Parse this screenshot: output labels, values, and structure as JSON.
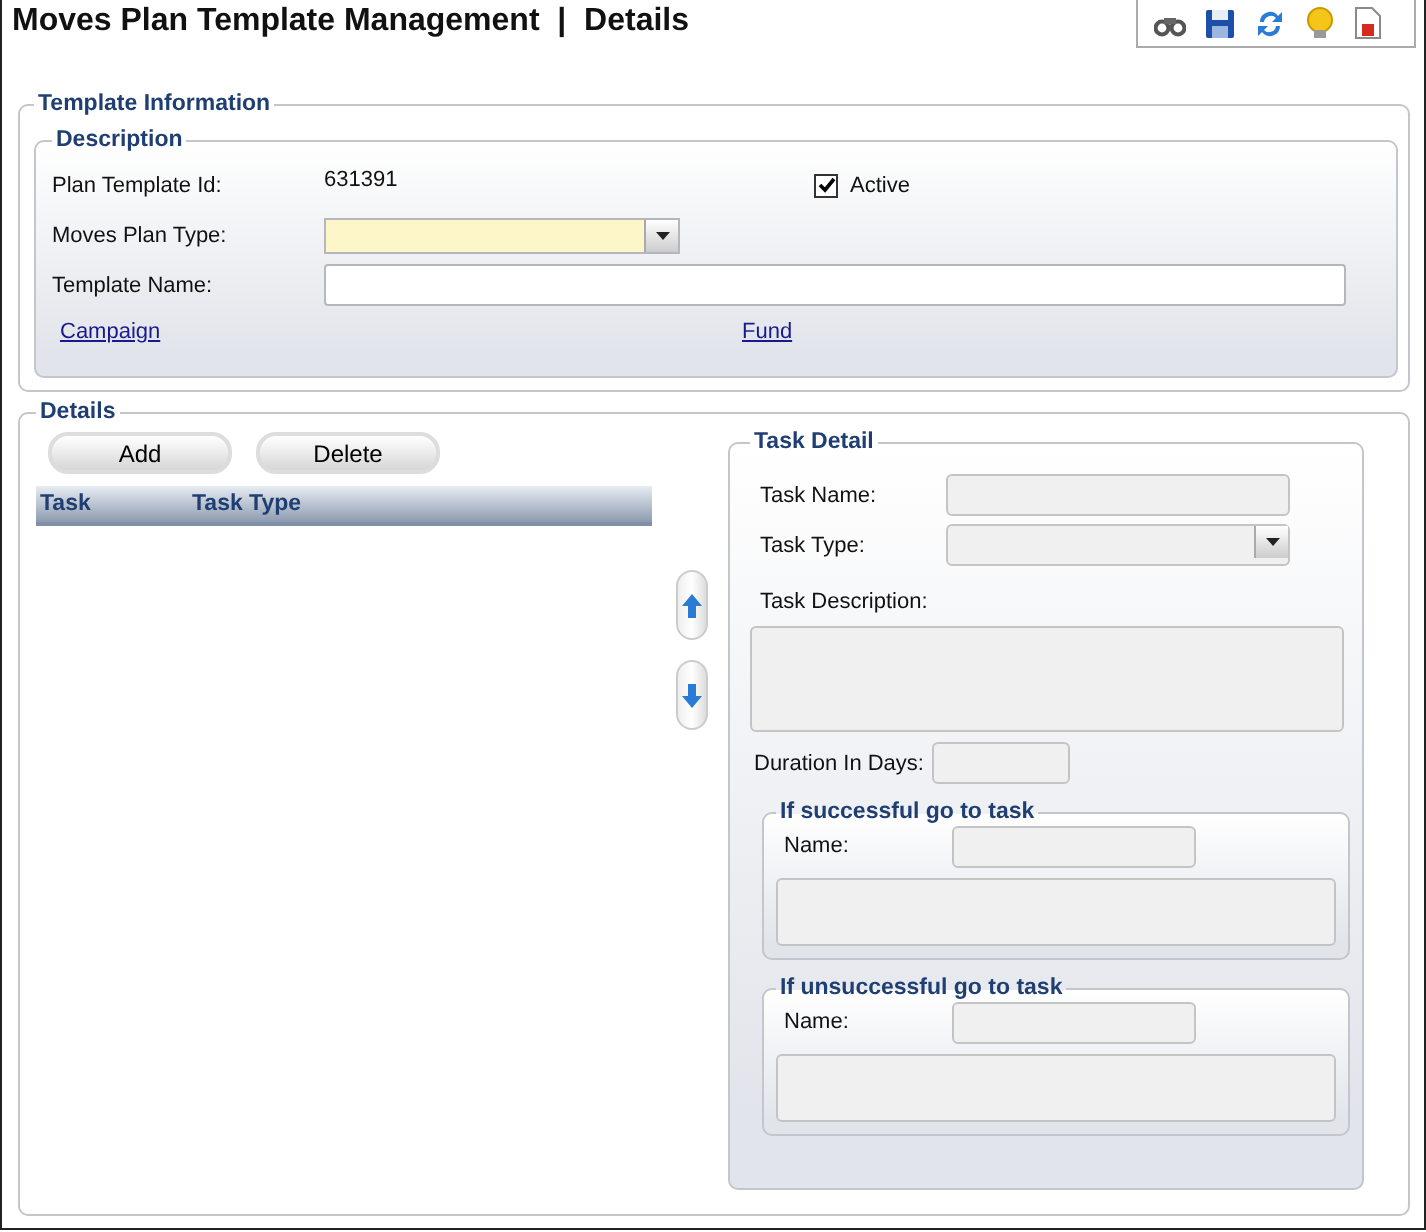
{
  "header": {
    "title": "Moves Plan Template Management  |  Details"
  },
  "template_information": {
    "legend": "Template Information",
    "description": {
      "legend": "Description",
      "plan_template_id": {
        "label": "Plan Template Id:",
        "value": "631391"
      },
      "active": {
        "label": "Active",
        "checked": true
      },
      "moves_plan_type": {
        "label": "Moves Plan Type:"
      },
      "template_name": {
        "label": "Template Name:"
      },
      "links": [
        "Campaign",
        "Fund"
      ]
    }
  },
  "details": {
    "legend": "Details",
    "buttons": [
      "Add",
      "Delete"
    ],
    "grid": {
      "columns": [
        "Task",
        "Task Type"
      ]
    },
    "task_detail": {
      "legend": "Task Detail",
      "task_name_label": "Task Name:",
      "task_type_label": "Task Type:",
      "task_description_label": "Task Description:",
      "duration_label": "Duration In Days:",
      "successful": {
        "legend": "If successful go to task",
        "name_label": "Name:"
      },
      "unsuccessful": {
        "legend": "If unsuccessful go to task",
        "name_label": "Name:"
      }
    }
  }
}
